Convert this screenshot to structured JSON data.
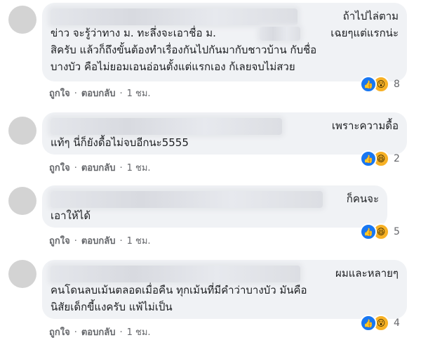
{
  "comments": [
    {
      "lines": [
        "ถ้าไปไล่ตาม",
        "ข่าว จะรู้ว่าทาง ม. ทะลึ่งจะเอาชื่อ ม.",
        "เฉยๆแต่แรกน่ะ",
        "สิครับ แล้วก็ถึงขั้นต้องทำเรื่องกันไปกันมากับชาวบ้าน กับชื่อ",
        "บางบัว คือไม่ยอมเอนอ่อนตั้งแต่แรกเอง ก้เลยจบไม่สวย"
      ],
      "reaction_count": "8",
      "reaction_icons": [
        "like-icon",
        "wow-icon"
      ],
      "like_label": "ถูกใจ",
      "reply_label": "ตอบกลับ",
      "time": "1 ชม."
    },
    {
      "lines": [
        "เพราะความดื้อ",
        "แท้ๆ นี่ก็ยังดื้อไม่จบอีกนะ5555"
      ],
      "reaction_count": "2",
      "reaction_icons": [
        "like-icon",
        "haha-icon"
      ],
      "like_label": "ถูกใจ",
      "reply_label": "ตอบกลับ",
      "time": "1 ชม."
    },
    {
      "lines": [
        "ก็คนจะ",
        "เอาให้ได้"
      ],
      "reaction_count": "5",
      "reaction_icons": [
        "like-icon",
        "haha-icon"
      ],
      "like_label": "ถูกใจ",
      "reply_label": "ตอบกลับ",
      "time": "1 ชม."
    },
    {
      "lines": [
        "ผมและหลายๆ",
        "คนโดนลบเม้นตลอดเมื่อคืน ทุกเม้นที่มีคำว่าบางบัว มันคือ",
        "นิสัยเด็กขี้แงครับ แพ้ไม่เป็น"
      ],
      "reaction_count": "4",
      "reaction_icons": [
        "like-icon",
        "wow-icon"
      ],
      "like_label": "ถูกใจ",
      "reply_label": "ตอบกลับ",
      "time": "1 ชม."
    }
  ],
  "colors": {
    "bubble": "#f0f2f5",
    "like_blue": "#1877f2",
    "reaction_yellow": "#f7b125",
    "meta_gray": "#65676b"
  }
}
